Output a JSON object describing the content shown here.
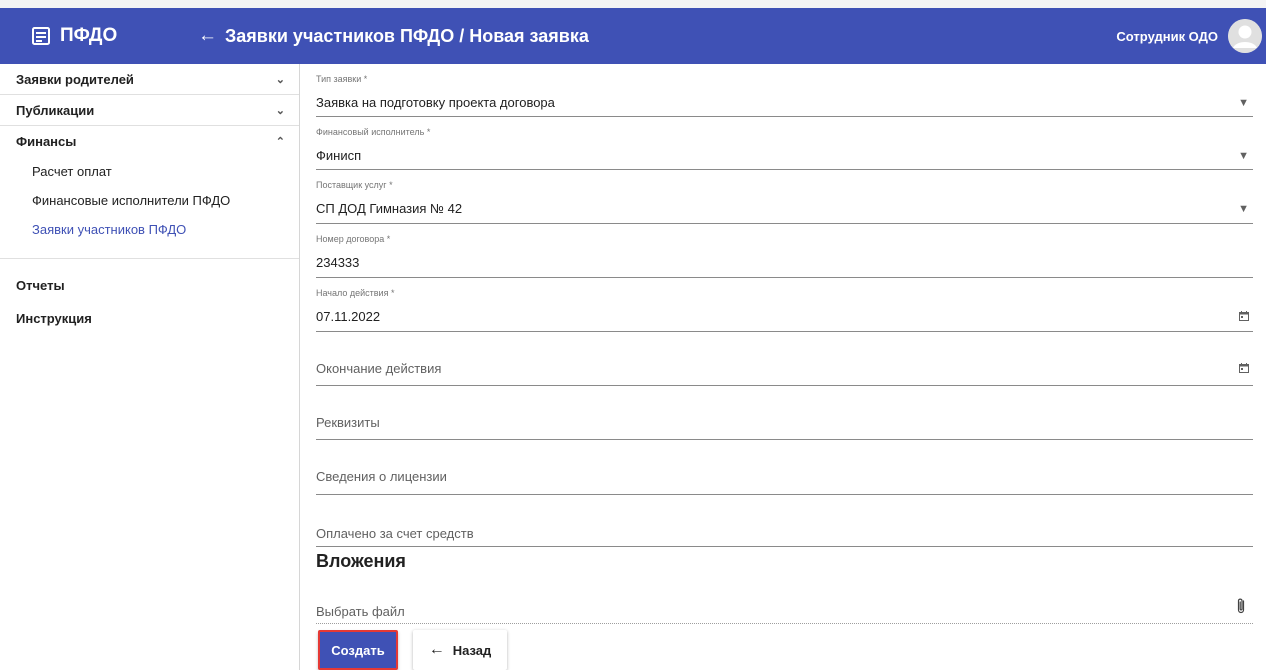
{
  "header": {
    "brand": "ПФДО",
    "title": "Заявки участников ПФДО / Новая заявка",
    "user": "Сотрудник ОДО"
  },
  "sidebar": {
    "groups": [
      {
        "label": "Заявки родителей",
        "state": "collapsed"
      },
      {
        "label": "Публикации",
        "state": "collapsed"
      },
      {
        "label": "Финансы",
        "state": "expanded"
      }
    ],
    "finance_items": [
      {
        "label": "Расчет оплат"
      },
      {
        "label": "Финансовые исполнители ПФДО"
      },
      {
        "label": "Заявки участников ПФДО",
        "active": true
      }
    ],
    "plain_items": [
      {
        "label": "Отчеты"
      },
      {
        "label": "Инструкция"
      }
    ]
  },
  "form": {
    "request_type": {
      "label": "Тип заявки *",
      "value": "Заявка на подготовку проекта договора"
    },
    "fin_executor": {
      "label": "Финансовый исполнитель *",
      "value": "Финисп"
    },
    "provider": {
      "label": "Поставщик услуг *",
      "value": "СП ДОД Гимназия № 42"
    },
    "contract_number": {
      "label": "Номер договора *",
      "value": "234333"
    },
    "start_date": {
      "label": "Начало действия *",
      "value": "07.11.2022"
    },
    "end_date": {
      "placeholder": "Окончание действия"
    },
    "requisites": {
      "placeholder": "Реквизиты"
    },
    "license": {
      "placeholder": "Сведения о лицензии"
    },
    "paid_from": {
      "placeholder": "Оплачено за счет средств"
    }
  },
  "attachments": {
    "title": "Вложения",
    "file_placeholder": "Выбрать файл"
  },
  "actions": {
    "create": "Создать",
    "back": "Назад"
  },
  "colors": {
    "primary": "#3f51b5",
    "highlight_border": "#e53935"
  }
}
